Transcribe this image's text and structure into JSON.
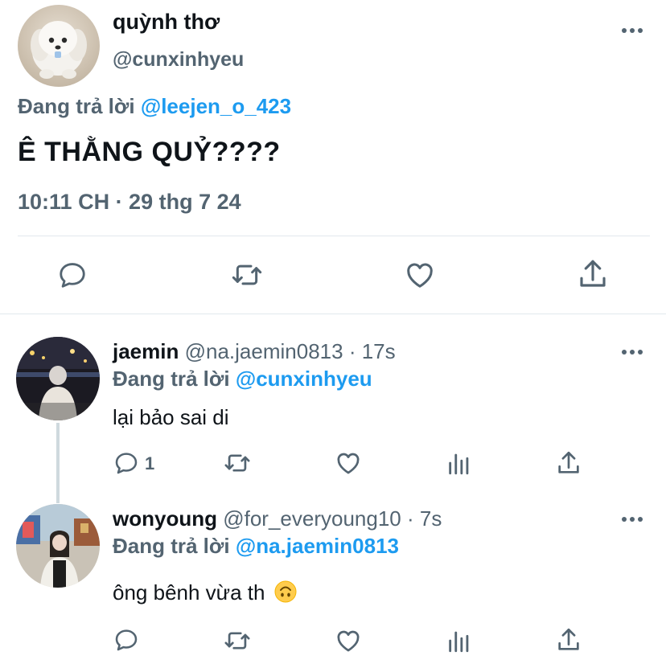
{
  "main_tweet": {
    "display_name": "quỳnh thơ",
    "handle": "@cunxinhyeu",
    "replying_prefix": "Đang trả lời",
    "replying_to": "@leejen_o_423",
    "text": "Ê THẰNG QUỶ????",
    "timestamp": "10:11 CH · 29 thg 7 24",
    "actions": [
      "reply-icon",
      "retweet-icon",
      "like-icon",
      "share-icon"
    ]
  },
  "replies": [
    {
      "display_name": "jaemin",
      "handle": "@na.jaemin0813",
      "time": "· 17s",
      "replying_prefix": "Đang trả lời",
      "replying_to": "@cunxinhyeu",
      "text": "lại bảo sai di",
      "reply_count": "1"
    },
    {
      "display_name": "wonyoung",
      "handle": "@for_everyoung10",
      "time": "· 7s",
      "replying_prefix": "Đang trả lời",
      "replying_to": "@na.jaemin0813",
      "text": "ông bênh vừa th",
      "emoji": "upside-down-face"
    }
  ],
  "colors": {
    "link_blue": "#1d9bf0",
    "secondary_gray": "#536471",
    "divider": "#e1e8ed",
    "text": "#0f1419"
  }
}
